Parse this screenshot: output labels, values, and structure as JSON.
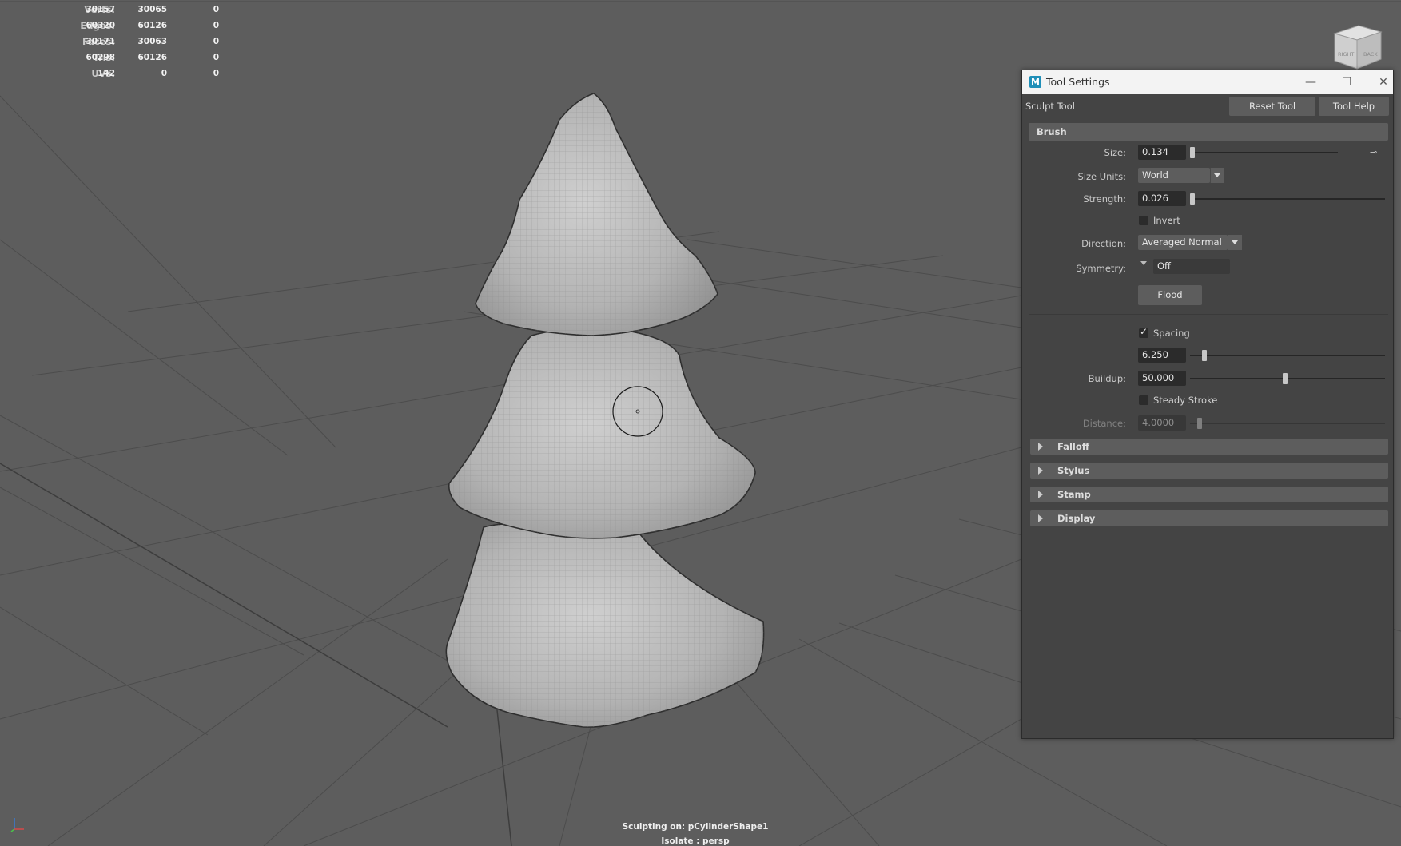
{
  "hud": {
    "rows": [
      {
        "label": "Verts:",
        "c1": "30157",
        "c2": "30065",
        "c3": "0"
      },
      {
        "label": "Edges:",
        "c1": "60320",
        "c2": "60126",
        "c3": "0"
      },
      {
        "label": "Faces:",
        "c1": "30171",
        "c2": "30063",
        "c3": "0"
      },
      {
        "label": "Tris:",
        "c1": "60298",
        "c2": "60126",
        "c3": "0"
      },
      {
        "label": "UVs:",
        "c1": "142",
        "c2": "0",
        "c3": "0"
      }
    ]
  },
  "viewport": {
    "status_line": "Sculpting on: pCylinderShape1",
    "isolate_line": "Isolate : persp",
    "viewcube_faces": [
      "RIGHT",
      "BACK"
    ]
  },
  "window": {
    "title": "Tool Settings",
    "app_icon": "M",
    "tool_name": "Sculpt Tool",
    "reset_button": "Reset Tool",
    "help_button": "Tool Help"
  },
  "brush": {
    "header": "Brush",
    "size_label": "Size:",
    "size_value": "0.134",
    "size_units_label": "Size Units:",
    "size_units_value": "World",
    "strength_label": "Strength:",
    "strength_value": "0.026",
    "invert_label": "Invert",
    "invert_checked": false,
    "direction_label": "Direction:",
    "direction_value": "Averaged Normal",
    "symmetry_label": "Symmetry:",
    "symmetry_value": "Off",
    "flood_button": "Flood",
    "spacing_label": "Spacing",
    "spacing_checked": true,
    "spacing_value": "6.250",
    "buildup_label": "Buildup:",
    "buildup_value": "50.000",
    "steady_label": "Steady Stroke",
    "steady_checked": false,
    "distance_label": "Distance:",
    "distance_value": "4.0000"
  },
  "sections": [
    "Falloff",
    "Stylus",
    "Stamp",
    "Display"
  ],
  "colors": {
    "viewport_bg": "#5d5d5d",
    "panel_bg": "#444444",
    "accent": "#1f8fb8"
  }
}
